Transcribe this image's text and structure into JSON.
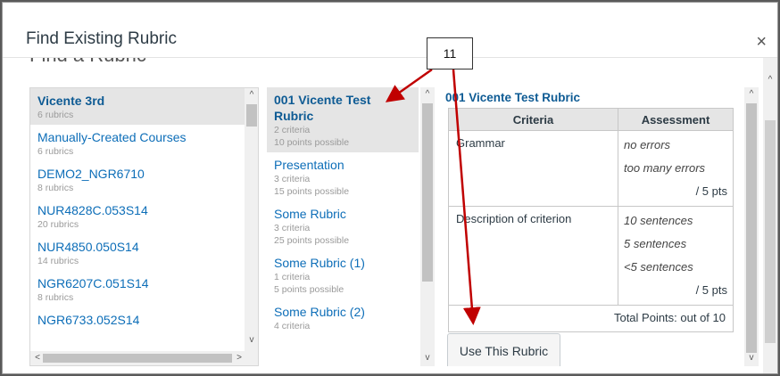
{
  "dialog": {
    "title": "Find Existing Rubric",
    "close_symbol": "×",
    "cut_heading": "Find a Rubric"
  },
  "courses": [
    {
      "name": "Vicente 3rd",
      "count": "6 rubrics",
      "selected": true
    },
    {
      "name": "Manually-Created Courses",
      "count": "6 rubrics"
    },
    {
      "name": "DEMO2_NGR6710",
      "count": "8 rubrics"
    },
    {
      "name": "NUR4828C.053S14",
      "count": "20 rubrics"
    },
    {
      "name": "NUR4850.050S14",
      "count": "14 rubrics"
    },
    {
      "name": "NGR6207C.051S14",
      "count": "8 rubrics"
    },
    {
      "name": "NGR6733.052S14",
      "count": ""
    }
  ],
  "rubrics": [
    {
      "name": "001 Vicente Test Rubric",
      "criteria": "2 criteria",
      "points": "10 points possible",
      "selected": true
    },
    {
      "name": "Presentation",
      "criteria": "3 criteria",
      "points": "15 points possible"
    },
    {
      "name": "Some Rubric",
      "criteria": "3 criteria",
      "points": "25 points possible"
    },
    {
      "name": "Some Rubric (1)",
      "criteria": "1 criteria",
      "points": "5 points possible"
    },
    {
      "name": "Some Rubric (2)",
      "criteria": "4 criteria",
      "points": ""
    }
  ],
  "preview": {
    "title": "001 Vicente Test Rubric",
    "col_criteria": "Criteria",
    "col_assessment": "Assessment",
    "rows": [
      {
        "criterion": "Grammar",
        "ratings": [
          "no errors",
          "too many errors"
        ],
        "points": "/ 5 pts"
      },
      {
        "criterion": "Description of criterion",
        "ratings": [
          "10 sentences",
          "5 sentences",
          "<5 sentences"
        ],
        "points": "/ 5 pts"
      }
    ],
    "total": "Total Points: out of 10",
    "use_button": "Use This Rubric"
  },
  "annotation": {
    "label": "11",
    "color": "#c00000"
  },
  "icons": {
    "up": "^",
    "down": "v",
    "left": "<",
    "right": ">"
  }
}
